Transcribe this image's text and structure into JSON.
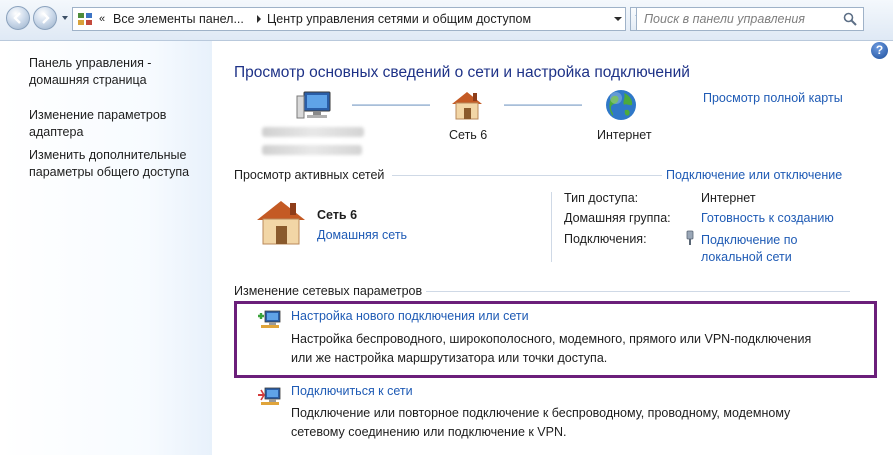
{
  "address_bar": {
    "breadcrumb_1": "Все элементы панел...",
    "breadcrumb_2": "Центр управления сетями и общим доступом",
    "search_placeholder": "Поиск в панели управления"
  },
  "sidebar": {
    "items": [
      {
        "label_line1": "Панель управления -",
        "label_line2": "домашняя страница"
      },
      {
        "label_line1": "Изменение параметров",
        "label_line2": "адаптера"
      },
      {
        "label_line1": "Изменить дополнительные",
        "label_line2": "параметры общего доступа"
      }
    ]
  },
  "main": {
    "title": "Просмотр основных сведений о сети и настройка подключений",
    "full_map_link": "Просмотр полной карты",
    "network_map": {
      "network_label": "Сеть  6",
      "internet_label": "Интернет"
    },
    "active_networks": {
      "title": "Просмотр активных сетей",
      "connect_link": "Подключение или отключение",
      "network_name": "Сеть  6",
      "network_type": "Домашняя сеть",
      "access_type_label": "Тип доступа:",
      "access_type_value": "Интернет",
      "homegroup_label": "Домашняя группа:",
      "homegroup_value": "Готовность к созданию",
      "connections_label": "Подключения:",
      "connections_value_line1": "Подключение по",
      "connections_value_line2": "локальной сети"
    },
    "change_settings": {
      "title": "Изменение сетевых параметров",
      "tasks": [
        {
          "link": "Настройка нового подключения или сети",
          "desc_line1": "Настройка беспроводного, широкополосного, модемного, прямого или VPN-подключения",
          "desc_line2": "или же настройка маршрутизатора или точки доступа."
        },
        {
          "link": "Подключиться к сети",
          "desc_line1": "Подключение или повторное подключение к беспроводному, проводному, модемному",
          "desc_line2": "сетевому соединению или подключение к VPN."
        }
      ]
    }
  },
  "colors": {
    "link": "#1f5bb5",
    "title": "#1e3287",
    "highlight_border": "#6b1f7a"
  }
}
